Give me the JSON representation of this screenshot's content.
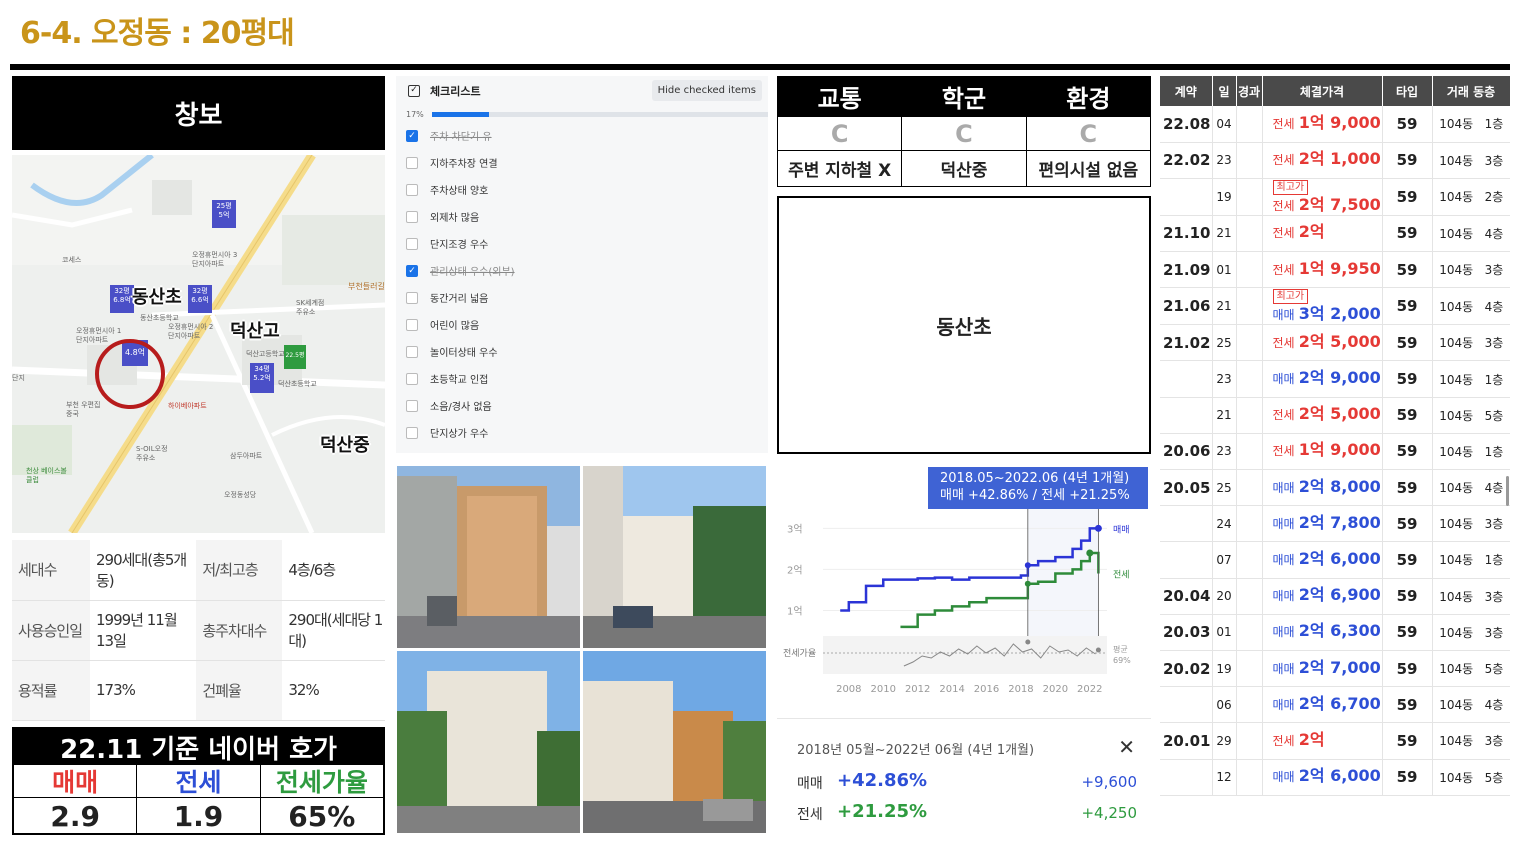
{
  "page_title": "6-4. 오정동 : 20평대",
  "apartment": {
    "name": "창보"
  },
  "map": {
    "school_labels": [
      "동산초",
      "덕산고",
      "덕산중"
    ],
    "markers": [
      {
        "top": "25평",
        "price": "5억"
      },
      {
        "top": "32평",
        "price": "6.8억"
      },
      {
        "top": "32평",
        "price": "6.6억"
      },
      {
        "top": "",
        "price": "4.8억"
      },
      {
        "top": "34평",
        "price": "5.2억"
      },
      {
        "top": "",
        "price": "22.5평"
      }
    ],
    "place_labels": [
      "코세스",
      "오정휴먼시아 3단지아파트",
      "동산초등학교",
      "오정휴먼시아 1단지아파트",
      "오정휴먼시아 2단지아파트",
      "SK세계점 주유소",
      "부천들러길",
      "덕산고등학교",
      "덕산초등학교",
      "부천 우편집중국",
      "S-OIL오정 주유소",
      "삼두아파트",
      "오정동성당",
      "천상 베이스볼클럽",
      "하이베아파트",
      "단지"
    ]
  },
  "info": {
    "rows": [
      {
        "k1": "세대수",
        "v1": "290세대(총5개동)",
        "k2": "저/최고층",
        "v2": "4층/6층"
      },
      {
        "k1": "사용승인일",
        "v1": "1999년 11월 13일",
        "k2": "총주차대수",
        "v2": "290대(세대당 1대)"
      },
      {
        "k1": "용적률",
        "v1": "173%",
        "k2": "건폐율",
        "v2": "32%"
      }
    ]
  },
  "hoga": {
    "title": "22.11 기준 네이버 호가",
    "headers": [
      "매매",
      "전세",
      "전세가율"
    ],
    "header_colors": [
      "#e53935",
      "#2d4fd6",
      "#2e9b3f"
    ],
    "values": [
      "2.9",
      "1.9",
      "65%"
    ]
  },
  "checklist": {
    "title": "체크리스트",
    "hide_button": "Hide checked items",
    "progress_label": "17%",
    "progress": 0.17,
    "items": [
      {
        "label": "주차 차단기 유",
        "checked": true
      },
      {
        "label": "지하주차장 연결",
        "checked": false
      },
      {
        "label": "주차상태 양호",
        "checked": false
      },
      {
        "label": "외제차 많음",
        "checked": false
      },
      {
        "label": "단지조경 우수",
        "checked": false
      },
      {
        "label": "관리상태 우수(외부)",
        "checked": true
      },
      {
        "label": "동간거리 넓음",
        "checked": false
      },
      {
        "label": "어린이 많음",
        "checked": false
      },
      {
        "label": "놀이터상태 우수",
        "checked": false
      },
      {
        "label": "초등학교 인접",
        "checked": false
      },
      {
        "label": "소음/경사 없음",
        "checked": false
      },
      {
        "label": "단지상가 우수",
        "checked": false
      }
    ]
  },
  "grades": {
    "headers": [
      "교통",
      "학군",
      "환경"
    ],
    "grades": [
      "C",
      "C",
      "C"
    ],
    "details": [
      "주변 지하철 X",
      "덕산중",
      "편의시설 없음"
    ]
  },
  "school_box": "동산초",
  "price_chart": {
    "tooltip_line1": "2018.05~2022.06 (4년 1개월)",
    "tooltip_line2": "매매 +42.86%  /  전세 +21.25%",
    "y_labels": [
      "3억",
      "2억",
      "1억"
    ],
    "x_labels": [
      "2008",
      "2010",
      "2012",
      "2014",
      "2016",
      "2018",
      "2020",
      "2022"
    ],
    "series_labels": [
      "매매",
      "전세"
    ],
    "ratio_label": "전세가율",
    "avg_label": "평균",
    "avg_value": "69%",
    "colors": {
      "sale": "#2b34d6",
      "jeonse": "#2e8b3a",
      "ratio": "#888888"
    }
  },
  "chart_data": {
    "type": "line",
    "x": [
      2007.5,
      2008,
      2009,
      2010,
      2011,
      2012,
      2013,
      2014,
      2015,
      2016,
      2017,
      2018,
      2018.4,
      2019,
      2020,
      2021,
      2021.5,
      2022,
      2022.5
    ],
    "series": [
      {
        "name": "매매",
        "values": [
          1.0,
          1.2,
          1.6,
          1.75,
          1.75,
          1.78,
          1.8,
          1.75,
          1.8,
          1.8,
          1.8,
          1.85,
          2.1,
          2.2,
          2.3,
          2.5,
          2.7,
          3.0,
          3.0
        ]
      },
      {
        "name": "전세",
        "values": [
          null,
          null,
          null,
          null,
          0.6,
          0.9,
          1.0,
          1.1,
          1.2,
          1.3,
          1.3,
          1.3,
          1.65,
          1.7,
          1.9,
          2.0,
          2.2,
          2.4,
          1.9
        ]
      }
    ],
    "ylabel": "",
    "xlabel": "",
    "ylim": [
      0.5,
      3.3
    ]
  },
  "summary": {
    "period": "2018년 05월~2022년 06월 (4년 1개월)",
    "close": "✕",
    "rows": [
      {
        "label": "매매",
        "pct": "+42.86%",
        "amount": "+9,600",
        "color": "#2d4fd6"
      },
      {
        "label": "전세",
        "pct": "+21.25%",
        "amount": "+4,250",
        "color": "#2e9b3f"
      }
    ]
  },
  "deals": {
    "headers": [
      "계약",
      "일",
      "경과",
      "체결가격",
      "타입",
      "거래 동층"
    ],
    "rows": [
      {
        "ym": "22.08",
        "d": "04",
        "badge": "",
        "kind": "전세",
        "price": "1억 9,000",
        "type": "59",
        "dong": "104동",
        "floor": "1층"
      },
      {
        "ym": "22.02",
        "d": "23",
        "badge": "",
        "kind": "전세",
        "price": "2억 1,000",
        "type": "59",
        "dong": "104동",
        "floor": "3층"
      },
      {
        "ym": "",
        "d": "19",
        "badge": "최고가",
        "kind": "전세",
        "price": "2억 7,500",
        "type": "59",
        "dong": "104동",
        "floor": "2층"
      },
      {
        "ym": "21.10",
        "d": "21",
        "badge": "",
        "kind": "전세",
        "price": "2억",
        "type": "59",
        "dong": "104동",
        "floor": "4층"
      },
      {
        "ym": "21.09",
        "d": "01",
        "badge": "",
        "kind": "전세",
        "price": "1억 9,950",
        "type": "59",
        "dong": "104동",
        "floor": "3층"
      },
      {
        "ym": "21.06",
        "d": "21",
        "badge": "최고가",
        "kind": "매매",
        "price": "3억 2,000",
        "type": "59",
        "dong": "104동",
        "floor": "4층"
      },
      {
        "ym": "21.02",
        "d": "25",
        "badge": "",
        "kind": "전세",
        "price": "2억 5,000",
        "type": "59",
        "dong": "104동",
        "floor": "3층"
      },
      {
        "ym": "",
        "d": "23",
        "badge": "",
        "kind": "매매",
        "price": "2억 9,000",
        "type": "59",
        "dong": "104동",
        "floor": "1층"
      },
      {
        "ym": "",
        "d": "21",
        "badge": "",
        "kind": "전세",
        "price": "2억 5,000",
        "type": "59",
        "dong": "104동",
        "floor": "5층"
      },
      {
        "ym": "20.06",
        "d": "23",
        "badge": "",
        "kind": "전세",
        "price": "1억 9,000",
        "type": "59",
        "dong": "104동",
        "floor": "1층"
      },
      {
        "ym": "20.05",
        "d": "25",
        "badge": "",
        "kind": "매매",
        "price": "2억 8,000",
        "type": "59",
        "dong": "104동",
        "floor": "4층"
      },
      {
        "ym": "",
        "d": "24",
        "badge": "",
        "kind": "매매",
        "price": "2억 7,800",
        "type": "59",
        "dong": "104동",
        "floor": "3층"
      },
      {
        "ym": "",
        "d": "07",
        "badge": "",
        "kind": "매매",
        "price": "2억 6,000",
        "type": "59",
        "dong": "104동",
        "floor": "1층"
      },
      {
        "ym": "20.04",
        "d": "20",
        "badge": "",
        "kind": "매매",
        "price": "2억 6,900",
        "type": "59",
        "dong": "104동",
        "floor": "3층"
      },
      {
        "ym": "20.03",
        "d": "01",
        "badge": "",
        "kind": "매매",
        "price": "2억 6,300",
        "type": "59",
        "dong": "104동",
        "floor": "3층"
      },
      {
        "ym": "20.02",
        "d": "19",
        "badge": "",
        "kind": "매매",
        "price": "2억 7,000",
        "type": "59",
        "dong": "104동",
        "floor": "5층"
      },
      {
        "ym": "",
        "d": "06",
        "badge": "",
        "kind": "매매",
        "price": "2억 6,700",
        "type": "59",
        "dong": "104동",
        "floor": "4층"
      },
      {
        "ym": "20.01",
        "d": "29",
        "badge": "",
        "kind": "전세",
        "price": "2억",
        "type": "59",
        "dong": "104동",
        "floor": "3층"
      },
      {
        "ym": "",
        "d": "12",
        "badge": "",
        "kind": "매매",
        "price": "2억 6,000",
        "type": "59",
        "dong": "104동",
        "floor": "5층"
      }
    ]
  }
}
